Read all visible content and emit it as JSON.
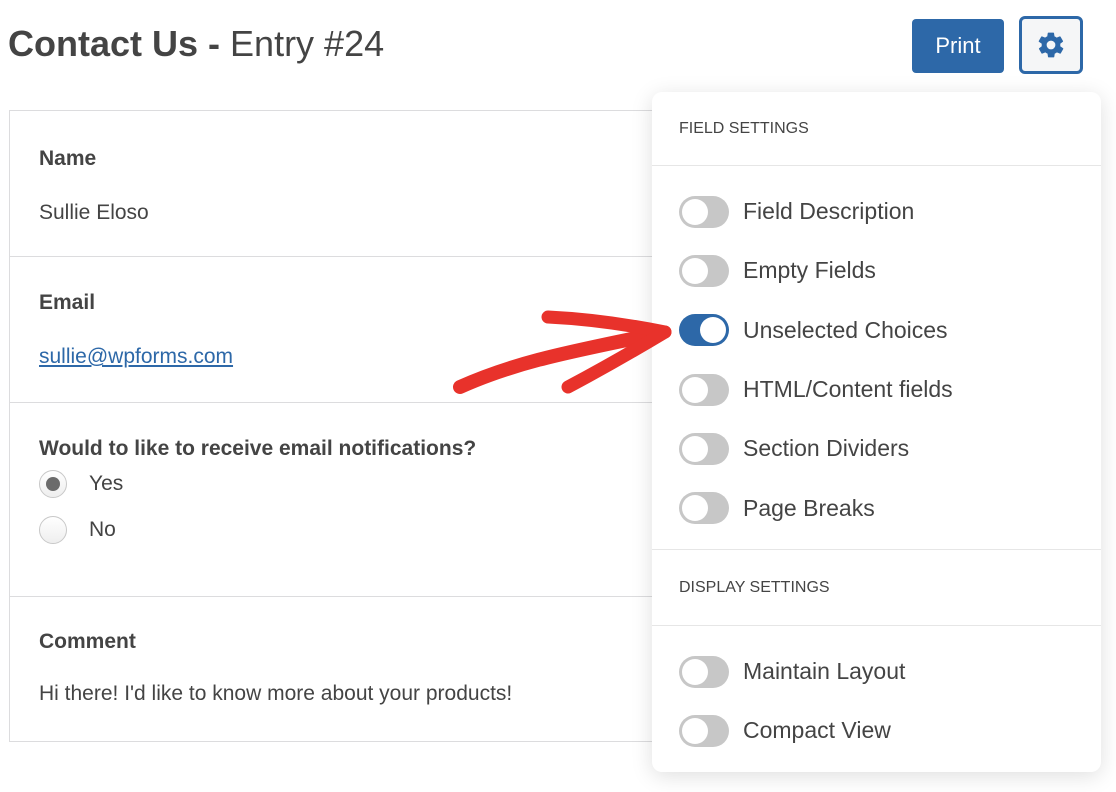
{
  "header": {
    "form_name": "Contact Us",
    "separator": " - ",
    "entry_label": "Entry #24",
    "print_label": "Print",
    "settings_icon": "gear-icon"
  },
  "colors": {
    "accent": "#2d68a8",
    "toggle_off": "#c7c7c7",
    "text": "#444444",
    "annotation_arrow": "#e8322b"
  },
  "entry": {
    "fields": [
      {
        "label": "Name",
        "value": "Sullie Eloso"
      },
      {
        "label": "Email",
        "value": "sullie@wpforms.com"
      },
      {
        "label": "Would to like to receive email notifications?",
        "choices": [
          {
            "label": "Yes",
            "selected": true
          },
          {
            "label": "No",
            "selected": false
          }
        ]
      },
      {
        "label": "Comment",
        "value": "Hi there! I'd like to know more about your products!"
      }
    ]
  },
  "settings_panel": {
    "field_settings": {
      "heading": "FIELD SETTINGS",
      "toggles": [
        {
          "label": "Field Description",
          "on": false
        },
        {
          "label": "Empty Fields",
          "on": false
        },
        {
          "label": "Unselected Choices",
          "on": true
        },
        {
          "label": "HTML/Content fields",
          "on": false
        },
        {
          "label": "Section Dividers",
          "on": false
        },
        {
          "label": "Page Breaks",
          "on": false
        }
      ]
    },
    "display_settings": {
      "heading": "DISPLAY SETTINGS",
      "toggles": [
        {
          "label": "Maintain Layout",
          "on": false
        },
        {
          "label": "Compact View",
          "on": false
        }
      ]
    }
  }
}
